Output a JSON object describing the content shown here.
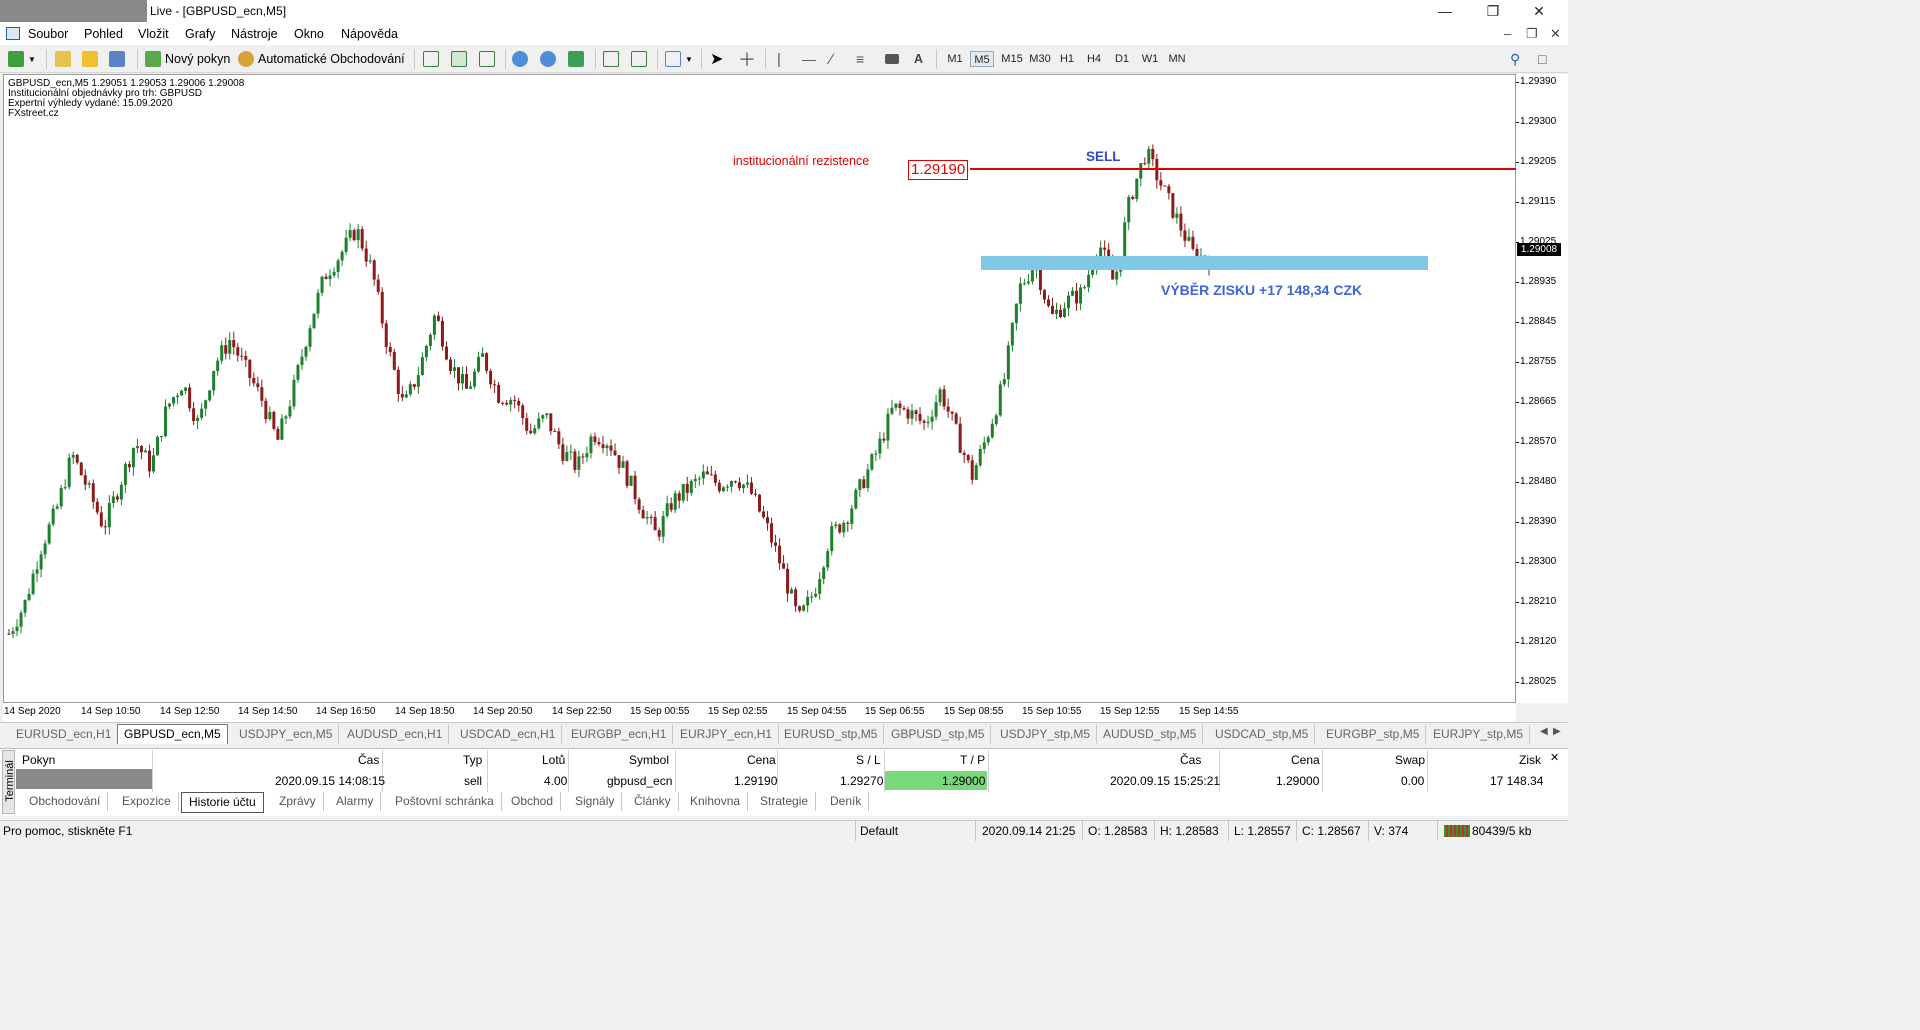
{
  "window": {
    "title": "Live - [GBPUSD_ecn,M5]"
  },
  "menu": [
    "Soubor",
    "Pohled",
    "Vložit",
    "Grafy",
    "Nástroje",
    "Okno",
    "Nápověda"
  ],
  "toolbar": {
    "new_order": "Nový pokyn",
    "auto_trading": "Automatické Obchodování",
    "text_tool": "A"
  },
  "timeframes": [
    "M1",
    "M5",
    "M15",
    "M30",
    "H1",
    "H4",
    "D1",
    "W1",
    "MN"
  ],
  "active_timeframe": "M5",
  "chart_info": {
    "line1": "GBPUSD_ecn,M5  1.29051 1.29053 1.29006 1.29008",
    "line2": "Institucionální objednávky pro trh: GBPUSD",
    "line3": "Expertní výhledy vydané: 15.09.2020",
    "line4": "FXstreet.cz"
  },
  "annotations": {
    "resistance_text": "institucionální rezistence",
    "resistance_price": "1.29190",
    "sell": "SELL",
    "profit": "VÝBĚR ZISKU +17 148,34 CZK"
  },
  "colors": {
    "bull": "#1e7f2d",
    "bear": "#8b1c1c",
    "resistance": "#e00000",
    "zone": "#7fc9e6",
    "sell": "#2f4bd0",
    "profit": "#3d66d6",
    "tp_cell": "#79d879"
  },
  "price_axis": {
    "ticks": [
      "1.29390",
      "1.29300",
      "1.29205",
      "1.29115",
      "1.29025",
      "1.28935",
      "1.28845",
      "1.28755",
      "1.28665",
      "1.28570",
      "1.28480",
      "1.28390",
      "1.28300",
      "1.28210",
      "1.28120",
      "1.28025"
    ],
    "current": "1.29008"
  },
  "time_axis": [
    "14 Sep 2020",
    "14 Sep 10:50",
    "14 Sep 12:50",
    "14 Sep 14:50",
    "14 Sep 16:50",
    "14 Sep 18:50",
    "14 Sep 20:50",
    "14 Sep 22:50",
    "15 Sep 00:55",
    "15 Sep 02:55",
    "15 Sep 04:55",
    "15 Sep 06:55",
    "15 Sep 08:55",
    "15 Sep 10:55",
    "15 Sep 12:55",
    "15 Sep 14:55"
  ],
  "chart_tabs": [
    "EURUSD_ecn,H1",
    "GBPUSD_ecn,M5",
    "USDJPY_ecn,M5",
    "AUDUSD_ecn,H1",
    "USDCAD_ecn,H1",
    "EURGBP_ecn,H1",
    "EURJPY_ecn,H1",
    "EURUSD_stp,M5",
    "GBPUSD_stp,M5",
    "USDJPY_stp,M5",
    "AUDUSD_stp,M5",
    "USDCAD_stp,M5",
    "EURGBP_stp,M5",
    "EURJPY_stp,M5"
  ],
  "active_chart_tab": 1,
  "terminal": {
    "side_label": "Terminál",
    "headers": {
      "order": "Pokyn",
      "time": "Čas",
      "type": "Typ",
      "lots": "Lotů",
      "symbol": "Symbol",
      "price": "Cena",
      "sl": "S / L",
      "tp": "T / P",
      "close_time": "Čas",
      "close_price": "Cena",
      "swap": "Swap",
      "profit": "Zisk"
    },
    "row": {
      "time": "2020.09.15 14:08:15",
      "type": "sell",
      "lots": "4.00",
      "symbol": "gbpusd_ecn",
      "price": "1.29190",
      "sl": "1.29270",
      "tp": "1.29000",
      "close_time": "2020.09.15 15:25:21",
      "close_price": "1.29000",
      "swap": "0.00",
      "profit": "17 148.34"
    },
    "tabs": [
      "Obchodování",
      "Expozice",
      "Historie účtu",
      "Zprávy",
      "Alarmy",
      "Poštovní schránka",
      "Obchod",
      "Signály",
      "Články",
      "Knihovna",
      "Strategie",
      "Deník"
    ],
    "active_tab": 2
  },
  "chart_data": {
    "type": "candlestick",
    "symbol": "GBPUSD_ecn",
    "timeframe": "M5",
    "ylim": [
      1.2797,
      1.2944
    ],
    "resistance": 1.2919,
    "profit_zone": [
      1.2899,
      1.2902
    ],
    "last": {
      "open": 1.29051,
      "high": 1.29053,
      "low": 1.29006,
      "close": 1.29008
    },
    "close_path": [
      1.2813,
      1.282,
      1.2833,
      1.2842,
      1.2855,
      1.2847,
      1.2838,
      1.2848,
      1.2858,
      1.2852,
      1.2866,
      1.2872,
      1.2862,
      1.2876,
      1.2882,
      1.2875,
      1.2868,
      1.2858,
      1.287,
      1.2885,
      1.2897,
      1.2902,
      1.2908,
      1.2898,
      1.288,
      1.2866,
      1.2875,
      1.2888,
      1.2876,
      1.287,
      1.2878,
      1.2869,
      1.2868,
      1.286,
      1.2864,
      1.2856,
      1.2852,
      1.286,
      1.2858,
      1.2851,
      1.2843,
      1.2836,
      1.2844,
      1.2847,
      1.285,
      1.2848,
      1.285,
      1.2846,
      1.2838,
      1.2828,
      1.2816,
      1.2823,
      1.2836,
      1.284,
      1.2848,
      1.2856,
      1.2866,
      1.2865,
      1.2862,
      1.287,
      1.286,
      1.285,
      1.286,
      1.2872,
      1.2894,
      1.29,
      1.2887,
      1.2891,
      1.2893,
      1.2905,
      1.2895,
      1.2915,
      1.2926,
      1.2918,
      1.291,
      1.2902,
      1.29008
    ]
  }
}
